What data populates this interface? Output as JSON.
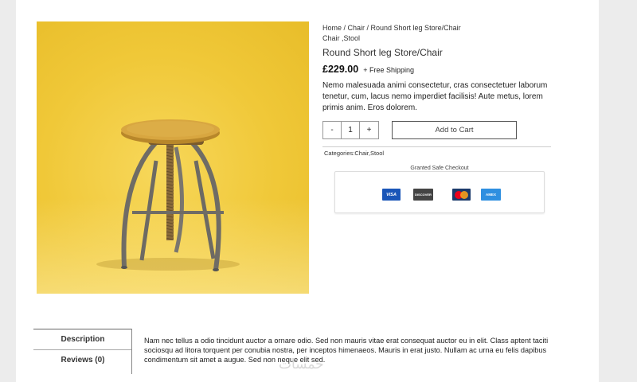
{
  "product": {
    "breadcrumb": {
      "line1": "Home / Chair / Round Short leg Store/Chair",
      "line2": "Chair ,Stool"
    },
    "title": "Round Short leg Store/Chair",
    "price": "£229.00",
    "shipping": "+ Free Shipping",
    "description": "Nemo malesuada animi consectetur, cras consectetuer laborum tenetur, cum, lacus nemo imperdiet facilisis! Aute metus, lorem primis anim. Eros dolorem.",
    "quantity": {
      "minus": "-",
      "value": "1",
      "plus": "+"
    },
    "add_to_cart": "Add to Cart",
    "categories": "Categories:Chair,Stool"
  },
  "checkout": {
    "label": "Granted Safe Checkout",
    "cards": [
      {
        "name": "VISA",
        "icon": "visa-card-icon",
        "color": "#1a56b8"
      },
      {
        "name": "DISCOVER",
        "icon": "discover-card-icon",
        "color": "#444444"
      },
      {
        "name": "",
        "icon": "mastercard-icon",
        "color": "#1b3a6b"
      },
      {
        "name": "AMEX",
        "icon": "amex-card-icon",
        "color": "#2e8fe0"
      }
    ]
  },
  "tabs": [
    {
      "label": "Description",
      "active": true
    },
    {
      "label": "Reviews (0)",
      "active": false
    }
  ],
  "tab_content": "Nam nec tellus a odio tincidunt auctor a ornare odio. Sed non mauris vitae erat consequat auctor eu in elit. Class aptent taciti sociosqu ad litora torquent per conubia nostra, per inceptos himenaeos. Mauris in erat justo. Nullam ac urna eu felis dapibus condimentum sit amet a augue. Sed non neque elit sed.",
  "watermark": "خمسات",
  "colors": {
    "image_background": "#f0c838",
    "page_background": "#ececec"
  }
}
